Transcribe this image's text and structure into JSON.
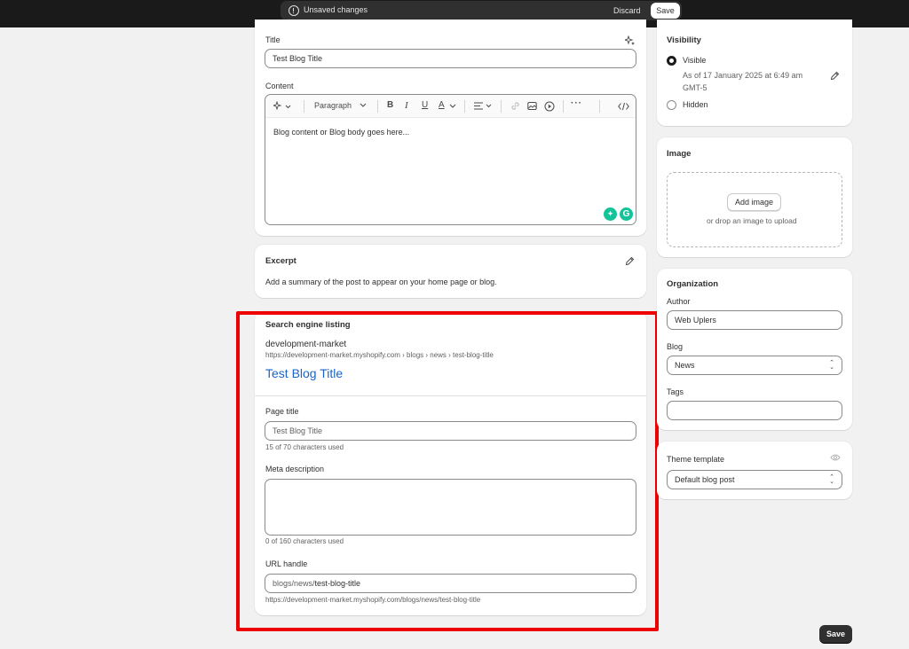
{
  "top_bar": {
    "unsaved_message": "Unsaved changes",
    "discard_label": "Discard",
    "save_label": "Save"
  },
  "post_card": {
    "title_label": "Title",
    "title_value": "Test Blog Title",
    "content_label": "Content",
    "toolbar": {
      "paragraph_style": "Paragraph",
      "icons": [
        "ai-sparkle-icon",
        "bold-icon",
        "italic-icon",
        "underline-icon",
        "text-color-icon",
        "align-icon",
        "link-icon",
        "image-icon",
        "video-icon",
        "more-icon",
        "code-icon"
      ]
    },
    "body_text": "Blog content or Blog body goes here..."
  },
  "excerpt": {
    "heading": "Excerpt",
    "description": "Add a summary of the post to appear on your home page or blog."
  },
  "seo": {
    "heading": "Search engine listing",
    "store_name": "development-market",
    "breadcrumb_url": "https://development-market.myshopify.com › blogs › news › test-blog-title",
    "preview_title": "Test Blog Title",
    "page_title_label": "Page title",
    "page_title_placeholder": "Test Blog Title",
    "page_title_count": "15 of 70 characters used",
    "meta_label": "Meta description",
    "meta_count": "0 of 160 characters used",
    "url_label": "URL handle",
    "url_prefix": "blogs/news/",
    "url_handle": "test-blog-title",
    "full_url": "https://development-market.myshopify.com/blogs/news/test-blog-title"
  },
  "visibility": {
    "heading": "Visibility",
    "visible_label": "Visible",
    "visible_date": "As of 17 January 2025 at 6:49 am",
    "visible_tz": "GMT-5",
    "hidden_label": "Hidden"
  },
  "image": {
    "heading": "Image",
    "add_label": "Add image",
    "drop_text": "or drop an image to upload"
  },
  "organization": {
    "heading": "Organization",
    "author_label": "Author",
    "author_value": "Web Uplers",
    "blog_label": "Blog",
    "blog_value": "News",
    "tags_label": "Tags",
    "tags_value": ""
  },
  "theme": {
    "heading": "Theme template",
    "template_value": "Default blog post"
  },
  "footer": {
    "save_label": "Save"
  }
}
